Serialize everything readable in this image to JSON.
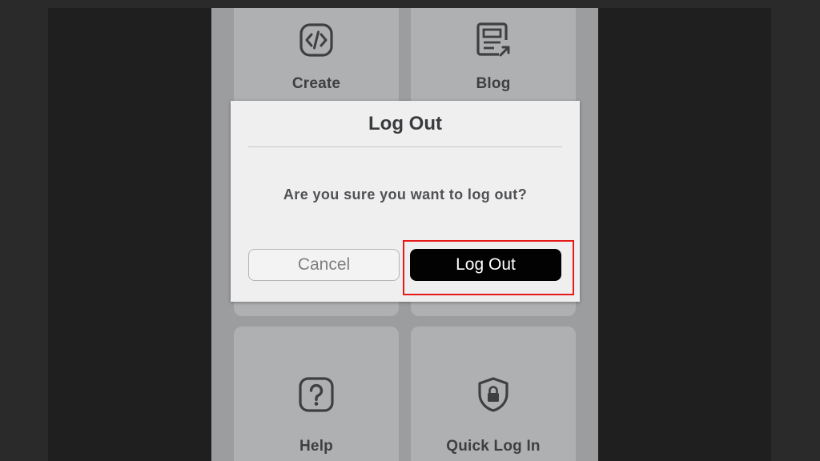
{
  "tiles": {
    "create": {
      "label": "Create",
      "icon": "code-icon"
    },
    "blog": {
      "label": "Blog",
      "icon": "news-icon"
    },
    "help": {
      "label": "Help",
      "icon": "question-icon"
    },
    "quick_login": {
      "label": "Quick Log In",
      "icon": "shield-lock-icon"
    }
  },
  "modal": {
    "title": "Log Out",
    "message": "Are you sure you want to log out?",
    "cancel_label": "Cancel",
    "confirm_label": "Log Out"
  },
  "colors": {
    "highlight": "#e51b1b",
    "confirm_bg": "#020202",
    "modal_bg": "#efeff0"
  }
}
